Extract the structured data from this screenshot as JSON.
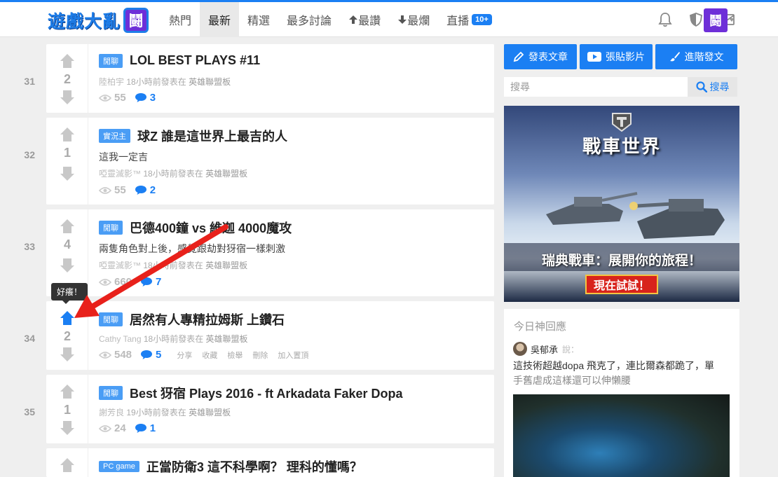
{
  "header": {
    "logo_text": "遊戲大亂",
    "logo_mark": "鬪",
    "nav": [
      {
        "label": "熱門",
        "active": false
      },
      {
        "label": "最新",
        "active": true
      },
      {
        "label": "精選",
        "active": false
      },
      {
        "label": "最多討論",
        "active": false
      },
      {
        "label": "最讚",
        "active": false
      },
      {
        "label": "最爛",
        "active": false
      },
      {
        "label": "直播",
        "active": false
      }
    ],
    "live_badge": "10+",
    "avatar_text": "鬪"
  },
  "posts": [
    {
      "rank": "31",
      "votes": "2",
      "tag": "閒聊",
      "title": "LOL BEST PLAYS #11",
      "desc": "",
      "author": "陸柏宇",
      "time": "18小時前發表在",
      "board": "英雄聯盟板",
      "views": "55",
      "comments": "3"
    },
    {
      "rank": "32",
      "votes": "1",
      "tag": "實況主",
      "title": "球Z 誰是這世界上最吉的人",
      "desc": "這我一定吉",
      "author": "啞靈滅影™",
      "time": "18小時前發表在",
      "board": "英雄聯盟板",
      "views": "55",
      "comments": "2"
    },
    {
      "rank": "33",
      "votes": "4",
      "tag": "閒聊",
      "title": "巴德400鐘 vs 維迦 4000魔攻",
      "desc": "兩隻角色對上後，感覺跟劫對犽宿一樣刺激",
      "author": "啞靈滅影™",
      "time": "18小時前發表在",
      "board": "英雄聯盟板",
      "views": "660",
      "comments": "7"
    },
    {
      "rank": "34",
      "votes": "2",
      "tag": "閒聊",
      "title": "居然有人專精拉姆斯 上鑽石",
      "desc": "",
      "author": "Cathy Tang",
      "time": "18小時前發表在",
      "board": "英雄聯盟板",
      "views": "548",
      "comments": "5"
    },
    {
      "rank": "35",
      "votes": "1",
      "tag": "閒聊",
      "title": "Best 犽宿 Plays 2016 - ft Arkadata Faker Dopa",
      "desc": "",
      "author": "謝芳良",
      "time": "19小時前發表在",
      "board": "英雄聯盟板",
      "views": "24",
      "comments": "1"
    },
    {
      "rank": "",
      "votes": "",
      "tag": "PC game",
      "title": "正當防衛3 這不科學啊？ 理科的懂嗎？",
      "desc": "",
      "author": "",
      "time": "",
      "board": "",
      "views": "",
      "comments": ""
    }
  ],
  "post_actions": [
    "分享",
    "收藏",
    "檢舉",
    "刪除",
    "加入置頂"
  ],
  "tooltip": "好癢！",
  "sidebar": {
    "buttons": [
      "發表文章",
      "張貼影片",
      "進階發文"
    ],
    "search_placeholder": "搜尋",
    "search_button": "搜尋",
    "ad": {
      "title": "戰車世界",
      "tagline": "瑞典戰車：展開你的旅程！",
      "cta": "現在試試！"
    },
    "god_reply": {
      "title": "今日神回應",
      "user": "吳郁承",
      "said": "說：",
      "text": "這技術超越dopa 飛克了，連比爾森都跪了，單",
      "text_fade": "手舊虐成這樣還可以伸懶腰"
    }
  },
  "colors": {
    "accent": "#1b7ff3",
    "arrow": "#e8211b"
  }
}
